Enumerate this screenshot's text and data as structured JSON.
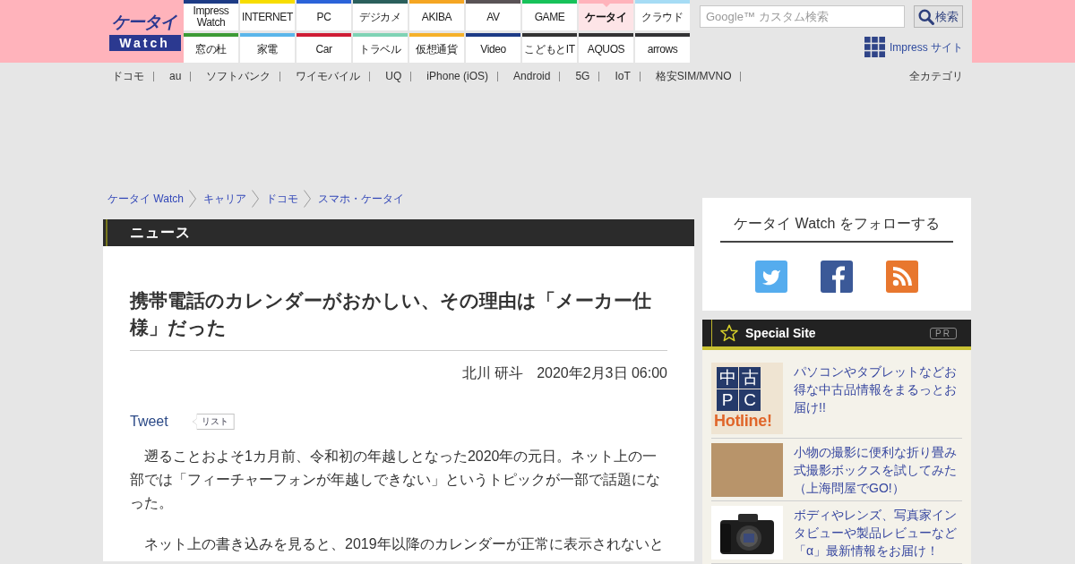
{
  "header": {
    "logo": {
      "top": "ケータイ",
      "bottom": "Watch"
    },
    "nav_rows": [
      [
        {
          "label": "Impress Watch",
          "color": "#1d3b85",
          "selected": false
        },
        {
          "label": "INTERNET",
          "color": "#f7dd00",
          "selected": false
        },
        {
          "label": "PC",
          "color": "#2b63d9",
          "selected": false
        },
        {
          "label": "デジカメ",
          "color": "#2a5f5c",
          "selected": false
        },
        {
          "label": "AKIBA",
          "color": "#f5a623",
          "selected": false
        },
        {
          "label": "AV",
          "color": "#5a5356",
          "selected": false
        },
        {
          "label": "GAME",
          "color": "#17c25a",
          "selected": false
        },
        {
          "label": "ケータイ",
          "color": "#ffb3bb",
          "selected": true
        },
        {
          "label": "クラウド",
          "color": "#a6dcf5",
          "selected": false
        }
      ],
      [
        {
          "label": "窓の杜",
          "color": "#3d9b35",
          "selected": false
        },
        {
          "label": "家電",
          "color": "#5bb6ea",
          "selected": false
        },
        {
          "label": "Car",
          "color": "#cf1d35",
          "selected": false
        },
        {
          "label": "トラベル",
          "color": "#7fd3b5",
          "selected": false
        },
        {
          "label": "仮想通貨",
          "color": "#f5b12a",
          "selected": false
        },
        {
          "label": "Video",
          "color": "#1d3b86",
          "selected": false
        },
        {
          "label": "こどもとIT",
          "color": "#333333",
          "selected": false
        },
        {
          "label": "AQUOS",
          "color": "#333334",
          "selected": false
        },
        {
          "label": "arrows",
          "color": "#333335",
          "selected": false
        }
      ]
    ],
    "search": {
      "placeholder": "Google™ カスタム検索",
      "button": "検索"
    },
    "sites_link": "Impress サイト"
  },
  "category_nav": {
    "items": [
      "ドコモ",
      "au",
      "ソフトバンク",
      "ワイモバイル",
      "UQ",
      "iPhone (iOS)",
      "Android",
      "5G",
      "IoT",
      "格安SIM/MVNO"
    ],
    "all": "全カテゴリ"
  },
  "breadcrumb": [
    "ケータイ Watch",
    "キャリア",
    "ドコモ",
    "スマホ・ケータイ"
  ],
  "section_title": "ニュース",
  "article": {
    "title": "携帯電話のカレンダーがおかしい、その理由は「メーカー仕様」だった",
    "author": "北川 研斗",
    "date": "2020年2月3日 06:00",
    "tweet": "Tweet",
    "list_button": "リスト",
    "paragraphs": [
      "　遡ることおよそ1カ月前、令和初の年越しとなった2020年の元日。ネット上の一部では「フィーチャーフォンが年越しできない」というトピックが一部で話題になった。",
      "　ネット上の書き込みを見ると、2019年以降のカレンダーが正常に表示されないと"
    ]
  },
  "sidebar": {
    "follow": {
      "title": "ケータイ Watch をフォローする",
      "icons": [
        {
          "kind": "bird"
        },
        {
          "kind": "letter"
        },
        {
          "kind": "feed"
        }
      ]
    },
    "special": {
      "title": "Special Site",
      "badge": "PR",
      "items": [
        {
          "thumb": {
            "kind": "logo",
            "tiles": [
              "中",
              "古",
              "P",
              "C"
            ],
            "caption": "Hotline!"
          },
          "text": "パソコンやタブレットなどお得な中古品情報をまるっとお届け!!"
        },
        {
          "thumb": {
            "kind": "photo"
          },
          "text": "小物の撮影に便利な折り畳み式撮影ボックスを試してみた（上海問屋でGO!）"
        },
        {
          "thumb": {
            "kind": "camera"
          },
          "text": "ボディやレンズ、写真家インタビューや製品レビューなど「α」最新情報をお届け！"
        }
      ]
    }
  }
}
